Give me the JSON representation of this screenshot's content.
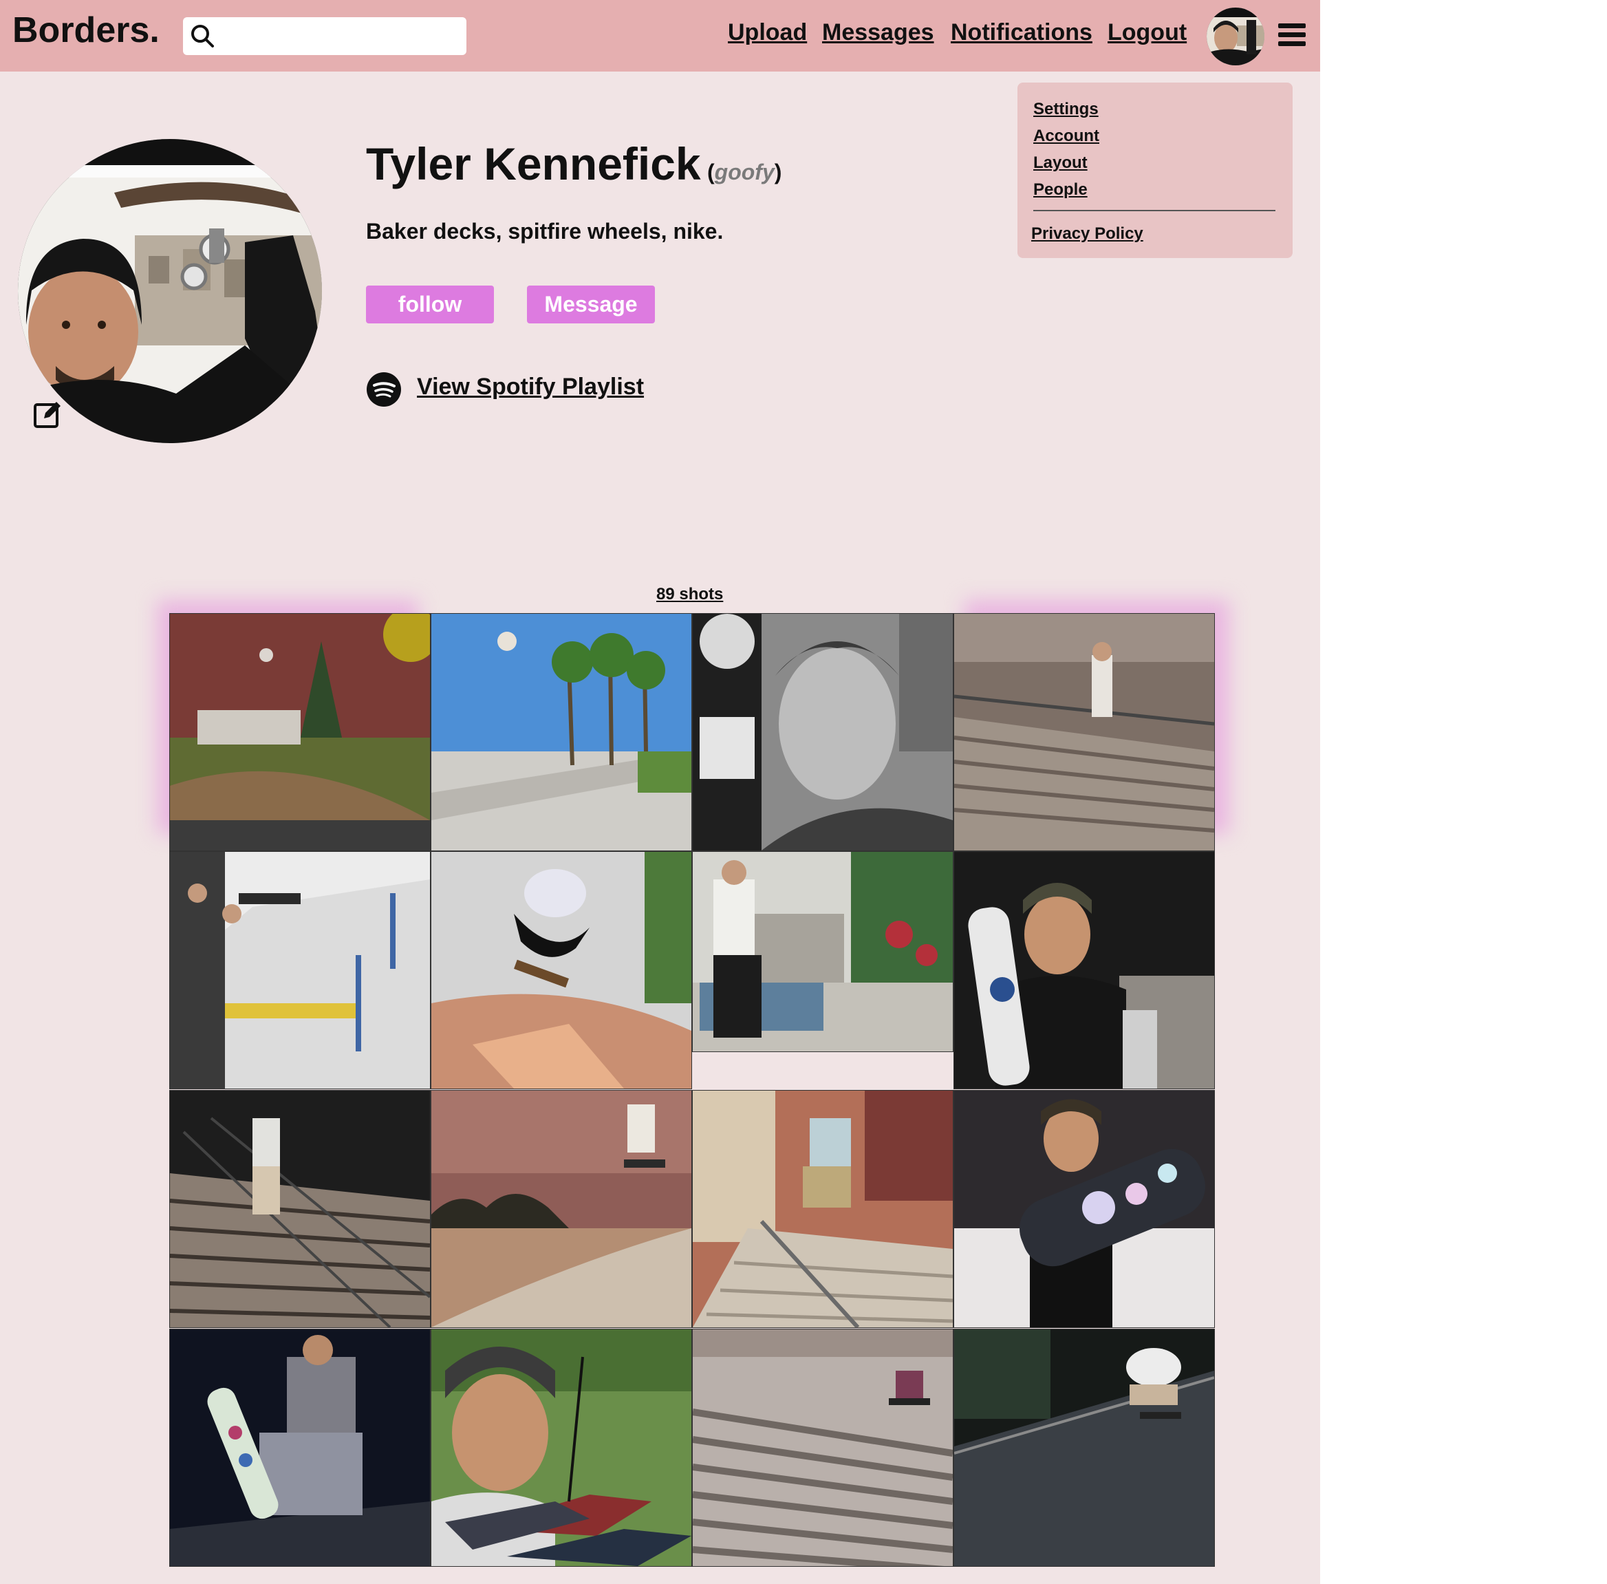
{
  "navbar": {
    "brand": "Borders.",
    "search": {
      "placeholder": "",
      "value": ""
    },
    "links": [
      "Upload",
      "Messages",
      "Notifications",
      "Logout"
    ]
  },
  "menu": {
    "items": [
      "Settings",
      "Account",
      "Layout",
      "People"
    ],
    "privacy": "Privacy Policy"
  },
  "profile": {
    "name": "Tyler Kennefick",
    "stance_open": "(",
    "stance": "goofy",
    "stance_close": ")",
    "bio": "Baker decks, spitfire wheels, nike.",
    "follow_label": "follow",
    "message_label": "Message",
    "spotify_label": "View Spotify Playlist"
  },
  "gallery": {
    "count_label": "89 shots",
    "tiles": [
      "skate-photo-1",
      "skate-photo-2",
      "skate-photo-3",
      "skate-photo-4",
      "skate-photo-5",
      "skate-photo-6",
      "skate-photo-7",
      "skate-photo-8",
      "skate-photo-9",
      "skate-photo-10",
      "skate-photo-11",
      "skate-photo-12",
      "skate-photo-13",
      "skate-photo-14",
      "skate-photo-15",
      "skate-photo-16"
    ]
  },
  "colors": {
    "navbar": "#e5afb0",
    "page": "#f1e4e5",
    "dropdown": "#e8c4c5",
    "button": "#dd7be0"
  }
}
